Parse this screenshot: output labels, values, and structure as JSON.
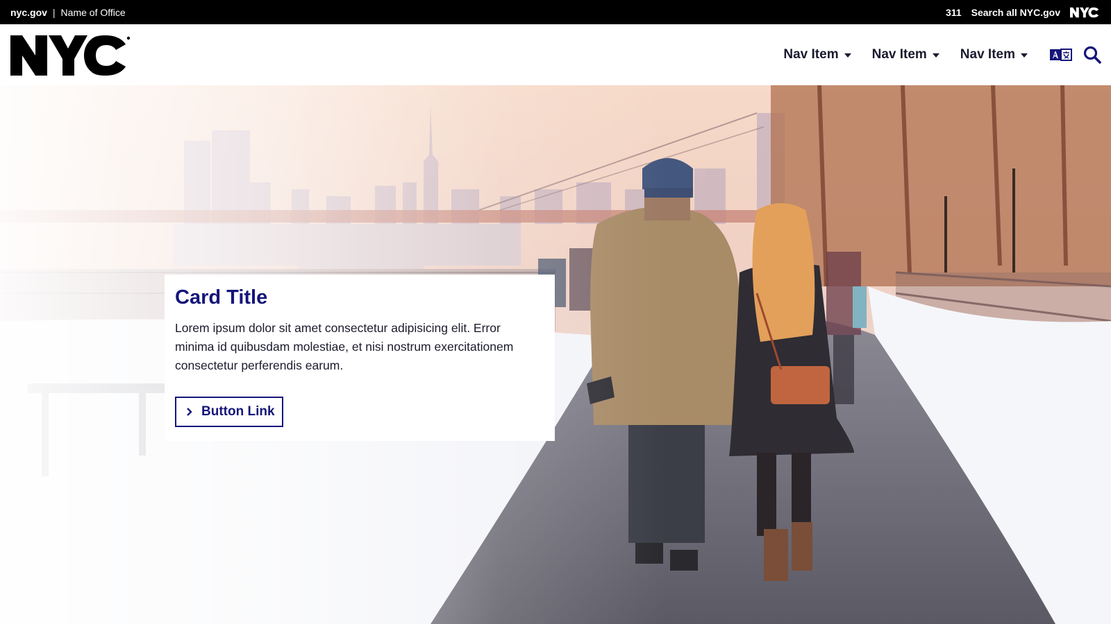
{
  "topbar": {
    "site": "nyc.gov",
    "separator": "|",
    "office": "Name of Office",
    "phone": "311",
    "search_all": "Search all NYC.gov"
  },
  "header": {
    "logo_text": "NYC",
    "nav": [
      {
        "label": "Nav Item"
      },
      {
        "label": "Nav Item"
      },
      {
        "label": "Nav Item"
      }
    ],
    "icons": {
      "translate": "translate-icon",
      "search": "search-icon"
    }
  },
  "hero": {
    "image_alt": "Couple walking on a snowy riverside promenade with bridge and city skyline",
    "card": {
      "title": "Card Title",
      "body": "Lorem ipsum dolor sit amet consectetur adipisicing elit. Error minima id quibusdam molestiae, et nisi nostrum exercitationem consectetur perferendis earum.",
      "button_label": "Button Link"
    }
  },
  "colors": {
    "topbar_bg": "#000000",
    "primary": "#15157a",
    "nav_text": "#1a1a2e"
  }
}
